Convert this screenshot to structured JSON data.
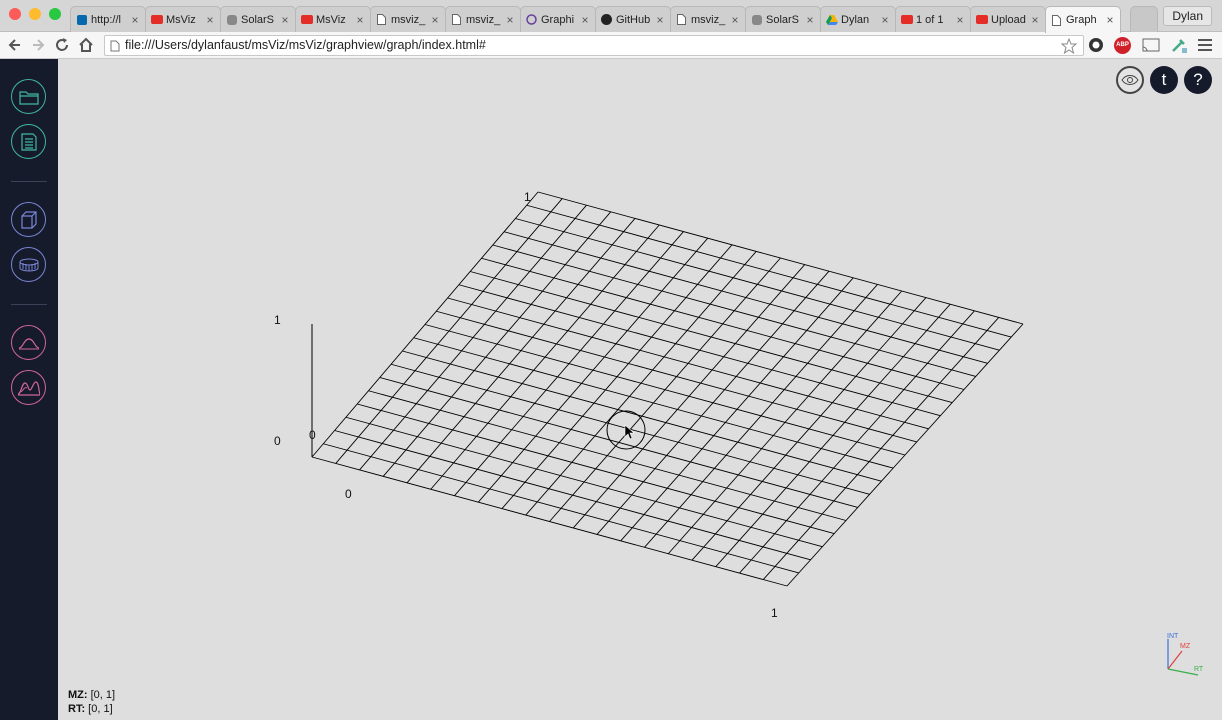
{
  "browser": {
    "tabs": [
      {
        "label": "http://l",
        "icon": "jquery-icon"
      },
      {
        "label": "MsViz",
        "icon": "youtube-icon"
      },
      {
        "label": "SolarS",
        "icon": "apple-icon"
      },
      {
        "label": "MsViz",
        "icon": "youtube-icon"
      },
      {
        "label": "msviz_",
        "icon": "page-icon"
      },
      {
        "label": "msviz_",
        "icon": "page-icon"
      },
      {
        "label": "Graphi",
        "icon": "graphiq-icon"
      },
      {
        "label": "GitHub",
        "icon": "github-icon"
      },
      {
        "label": "msviz_",
        "icon": "page-icon"
      },
      {
        "label": "SolarS",
        "icon": "apple-icon"
      },
      {
        "label": "Dylan",
        "icon": "google-drive-icon"
      },
      {
        "label": "1 of 1",
        "icon": "youtube-icon"
      },
      {
        "label": "Upload",
        "icon": "youtube-icon"
      },
      {
        "label": "Graph",
        "icon": "page-icon",
        "active": true
      }
    ],
    "close_glyph": "×",
    "profile": "Dylan",
    "url": "file:///Users/dylanfaust/msViz/msViz/graphview/graph/index.html#",
    "extension_badge": "ABP"
  },
  "colors": {
    "sidebar_bg": "#161b2b",
    "teal": "#3fb8a0",
    "purple": "#7a86d6",
    "pink": "#d0679a",
    "plot_bg": "#dedede",
    "grid": "#000000"
  },
  "sidebar": {
    "groups": [
      {
        "color": "teal",
        "icons": [
          "folder-open-icon",
          "save-file-icon"
        ]
      },
      {
        "color": "purple",
        "icons": [
          "cube-icon",
          "cylinder-icon"
        ]
      },
      {
        "color": "pink",
        "icons": [
          "peak-icon",
          "multi-peak-icon"
        ]
      }
    ]
  },
  "top_right_buttons": [
    {
      "name": "view-eye-button",
      "icon": "eye-icon"
    },
    {
      "name": "tutorial-button",
      "glyph": "t"
    },
    {
      "name": "help-button",
      "glyph": "?"
    }
  ],
  "graph": {
    "grid_divisions": 20,
    "mz_range": [
      0,
      1
    ],
    "rt_range": [
      0,
      1
    ],
    "int_range": [
      0,
      1
    ],
    "labels": {
      "mz_min": "0",
      "mz_max": "1",
      "rt_min": "0",
      "rt_max": "1",
      "int_min": "0",
      "int_max": "1",
      "origin_int": "0"
    }
  },
  "axis_gizmo": {
    "int": "INT",
    "mz": "MZ",
    "rt": "RT"
  },
  "ranges": {
    "mz_label": "MZ:",
    "mz_value": "[0, 1]",
    "rt_label": "RT:",
    "rt_value": "[0, 1]"
  }
}
